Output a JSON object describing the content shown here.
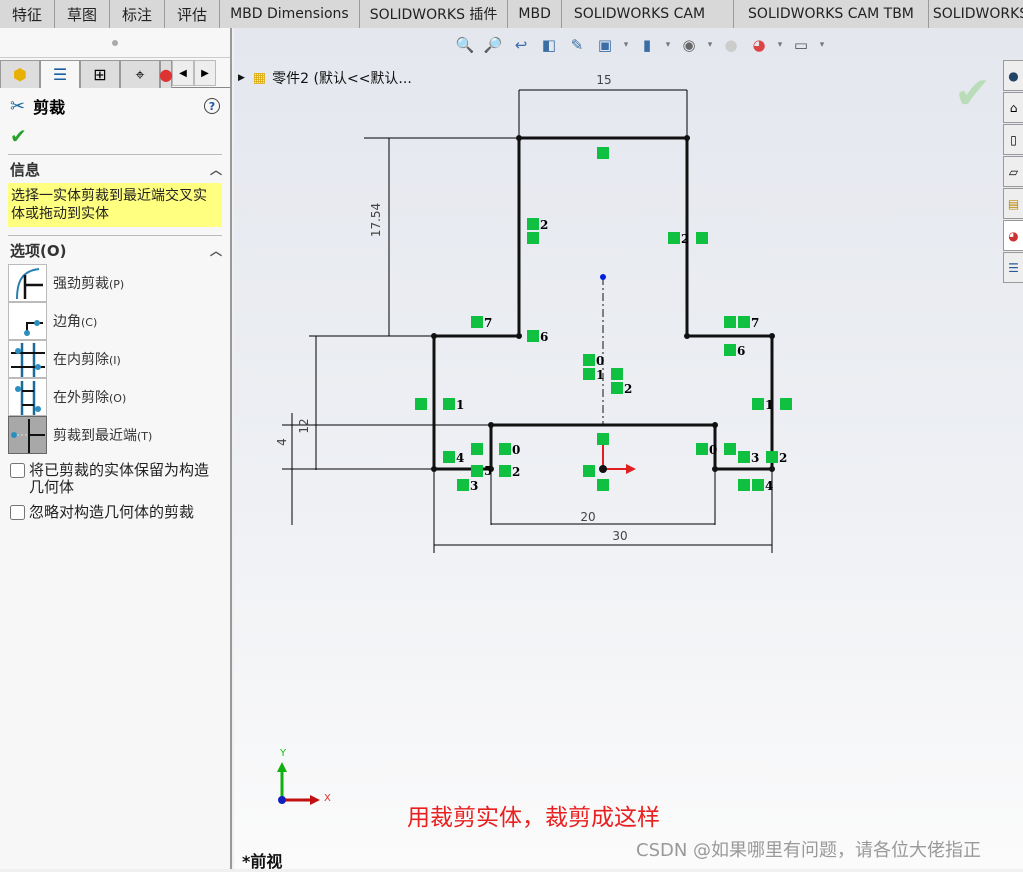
{
  "tabs": [
    "特征",
    "草图",
    "标注",
    "评估",
    "MBD Dimensions",
    "SOLIDWORKS 插件",
    "MBD",
    "SOLIDWORKS CAM",
    "SOLIDWORKS CAM TBM",
    "SOLIDWORKS In"
  ],
  "panel": {
    "title": "剪裁",
    "help": "?",
    "ok": "✔",
    "info": {
      "header": "信息",
      "message": "选择一实体剪裁到最近端交叉实体或拖动到实体"
    },
    "options": {
      "header": "选项(O)",
      "items": [
        {
          "label": "强劲剪裁",
          "key": "(P)"
        },
        {
          "label": "边角",
          "key": "(C)"
        },
        {
          "label": "在内剪除",
          "key": "(I)"
        },
        {
          "label": "在外剪除",
          "key": "(O)"
        },
        {
          "label": "剪裁到最近端",
          "key": "(T)",
          "selected": true
        }
      ]
    },
    "checks": [
      {
        "label": "将已剪裁的实体保留为构造几何体",
        "checked": false
      },
      {
        "label": "忽略对构造几何体的剪裁",
        "checked": false
      }
    ]
  },
  "tree": {
    "part": "零件2  (默认<<默认..."
  },
  "dimensions": {
    "top_width": "15",
    "height_upper": "17.54",
    "height_mid": "12",
    "height_low": "4",
    "inner_width": "20",
    "total_width": "30"
  },
  "relations": [
    "2",
    "2",
    "7",
    "6",
    "7",
    "6",
    "0",
    "1",
    "2",
    "1",
    "1",
    "0",
    "4",
    "5",
    "2",
    "3",
    "0",
    "3",
    "2",
    "4"
  ],
  "axes": {
    "x": "X",
    "y": "Y"
  },
  "view_name": "*前视",
  "annotation": "用裁剪实体，裁剪成这样",
  "watermark": "CSDN @如果哪里有问题，请各位大佬指正"
}
